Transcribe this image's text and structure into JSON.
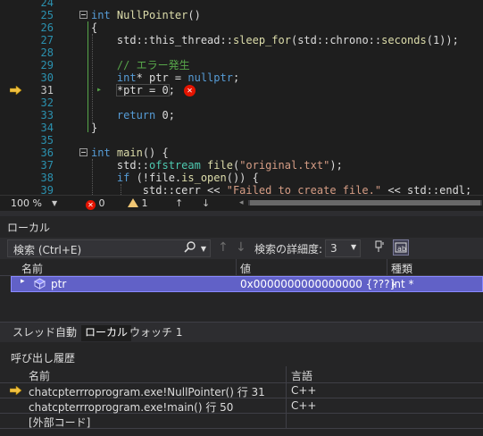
{
  "editor": {
    "lines": [
      {
        "n": "24",
        "html": ""
      },
      {
        "n": "25",
        "tokens": [
          [
            "kw",
            "int"
          ],
          [
            "",
            ""
          ],
          [
            "fn",
            " NullPointer"
          ],
          [
            "",
            "()"
          ]
        ]
      },
      {
        "n": "26",
        "text": "{"
      },
      {
        "n": "27",
        "tokens": [
          [
            "",
            "    std::this_thread::"
          ],
          [
            "fn",
            "sleep_for"
          ],
          [
            "",
            "(std::chrono::"
          ],
          [
            "fn",
            "seconds"
          ],
          [
            "",
            "(1));"
          ]
        ]
      },
      {
        "n": "28",
        "text": ""
      },
      {
        "n": "29",
        "tokens": [
          [
            "cmt",
            "    // エラー発生"
          ]
        ]
      },
      {
        "n": "30",
        "tokens": [
          [
            "kw",
            "    int"
          ],
          [
            "",
            "* ptr = "
          ],
          [
            "kw",
            "nullptr"
          ],
          [
            "",
            ";"
          ]
        ]
      },
      {
        "n": "31",
        "tokens": [
          [
            "",
            "    *ptr = 0;"
          ]
        ]
      },
      {
        "n": "32",
        "text": ""
      },
      {
        "n": "33",
        "tokens": [
          [
            "kw",
            "    return"
          ],
          [
            "",
            " 0;"
          ]
        ]
      },
      {
        "n": "34",
        "text": "}"
      },
      {
        "n": "35",
        "text": ""
      },
      {
        "n": "36",
        "tokens": [
          [
            "kw",
            "int"
          ],
          [
            "fn",
            " main"
          ],
          [
            "",
            "() {"
          ]
        ]
      },
      {
        "n": "37",
        "tokens": [
          [
            "",
            "    std::"
          ],
          [
            "typ",
            "ofstream"
          ],
          [
            "fn",
            " file"
          ],
          [
            "",
            "("
          ],
          [
            "str",
            "\"original.txt\""
          ],
          [
            "",
            ");"
          ]
        ]
      },
      {
        "n": "38",
        "tokens": [
          [
            "kw",
            "    if"
          ],
          [
            "",
            " (!file."
          ],
          [
            "fn",
            "is_open"
          ],
          [
            "",
            "()) {"
          ]
        ]
      },
      {
        "n": "39",
        "tokens": [
          [
            "",
            "        std::cerr << "
          ],
          [
            "str",
            "\"Failed to create file.\""
          ],
          [
            "",
            " << std::endl;"
          ]
        ]
      }
    ]
  },
  "status": {
    "zoom": "100 %",
    "errors": "0",
    "warnings": "1"
  },
  "locals": {
    "title": "ローカル",
    "search_placeholder": "検索 (Ctrl+E)",
    "depth_label": "検索の詳細度:",
    "depth_value": "3",
    "columns": {
      "name": "名前",
      "value": "値",
      "type": "種類"
    },
    "row": {
      "name": "ptr",
      "value": "0x0000000000000000 {???}",
      "type": "int *"
    }
  },
  "tabs": [
    "スレッド",
    "自動",
    "ローカル",
    "ウォッチ 1"
  ],
  "callstack": {
    "title": "呼び出し履歴",
    "columns": {
      "name": "名前",
      "lang": "言語"
    },
    "rows": [
      {
        "name": "chatcpterrroprogram.exe!NullPointer() 行 31",
        "lang": "C++"
      },
      {
        "name": "chatcpterrroprogram.exe!main() 行 50",
        "lang": "C++"
      },
      {
        "name": "[外部コード]",
        "lang": ""
      }
    ]
  },
  "colors": {
    "selection": "#6161c7",
    "error": "#e51400",
    "arrow": "#f0c040",
    "keyword": "#569cd6",
    "comment": "#57a64a"
  }
}
